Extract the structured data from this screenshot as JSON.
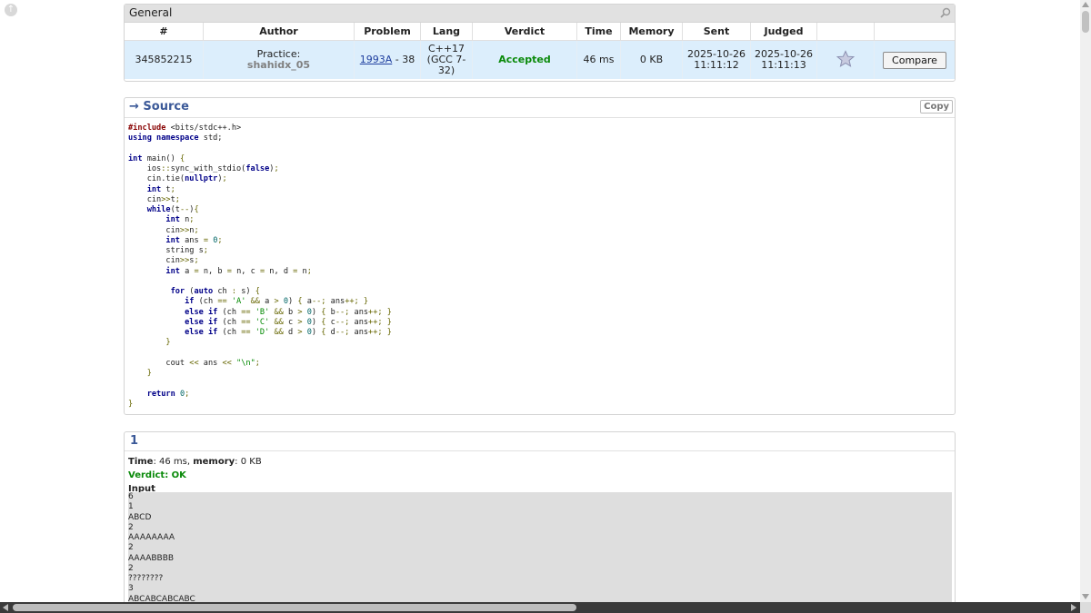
{
  "general": {
    "title": "General",
    "columns": [
      "#",
      "Author",
      "Problem",
      "Lang",
      "Verdict",
      "Time",
      "Memory",
      "Sent",
      "Judged",
      "",
      ""
    ],
    "row": {
      "id": "345852215",
      "author_prefix": "Practice:",
      "author_handle": "shahidx_05",
      "problem_link": "1993A",
      "problem_suffix": " - 38",
      "lang": "C++17 (GCC 7-32)",
      "verdict": "Accepted",
      "time": "46 ms",
      "memory": "0 KB",
      "sent": "2025-10-26 11:11:12",
      "judged": "2025-10-26 11:11:13",
      "compare_label": "Compare"
    }
  },
  "source": {
    "title": "→ Source",
    "copy_label": "Copy"
  },
  "test": {
    "number": "1",
    "time_label": "Time",
    "time_value": ": 46 ms, ",
    "memory_label": "memory",
    "memory_value": ": 0 KB",
    "verdict_label": "Verdict: OK",
    "input_label": "Input",
    "input_lines": [
      "6",
      "1",
      "ABCD",
      "2",
      "AAAAAAAA",
      "2",
      "AAAABBBB",
      "2",
      "????????",
      "3",
      "ABCABCABCABC"
    ]
  },
  "colors": {
    "accepted": "#0a8a0a",
    "link": "#2040a0",
    "section_title": "#3b5998",
    "row_bg": "#dceefc"
  }
}
